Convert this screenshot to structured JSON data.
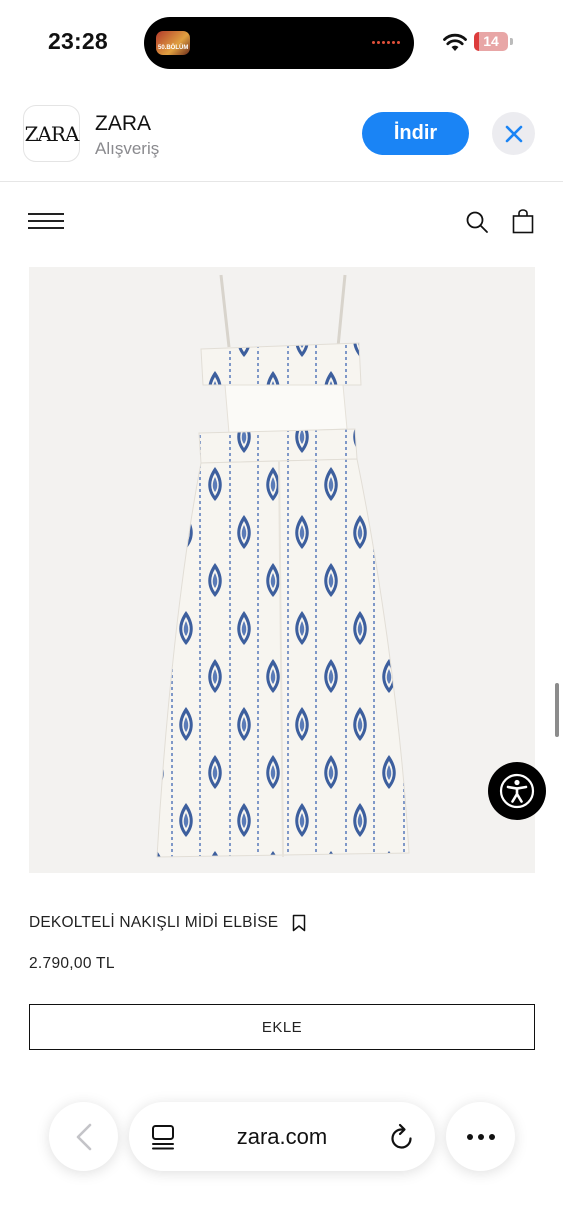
{
  "status_bar": {
    "time": "23:28",
    "island_app_label": "50.BÖLÜM",
    "battery_level": 14,
    "battery_text": "14"
  },
  "app_banner": {
    "app_icon_text": "ZARA",
    "app_name": "ZARA",
    "app_category": "Alışveriş",
    "download_label": "İndir",
    "accent_color": "#1a84f5"
  },
  "site_header": {
    "menu_icon": "hamburger-icon",
    "search_icon": "search-icon",
    "bag_icon": "shopping-bag-icon"
  },
  "product": {
    "name": "DEKOLTELİ NAKIŞLI MİDİ ELBİSE",
    "price": "2.790,00 TL",
    "add_label": "EKLE",
    "image_description_icon": "dress-image"
  },
  "browser": {
    "url": "zara.com",
    "back_icon": "chevron-left-icon",
    "tabs_icon": "tabs-icon",
    "reload_icon": "reload-icon",
    "more_icon": "more-icon"
  }
}
